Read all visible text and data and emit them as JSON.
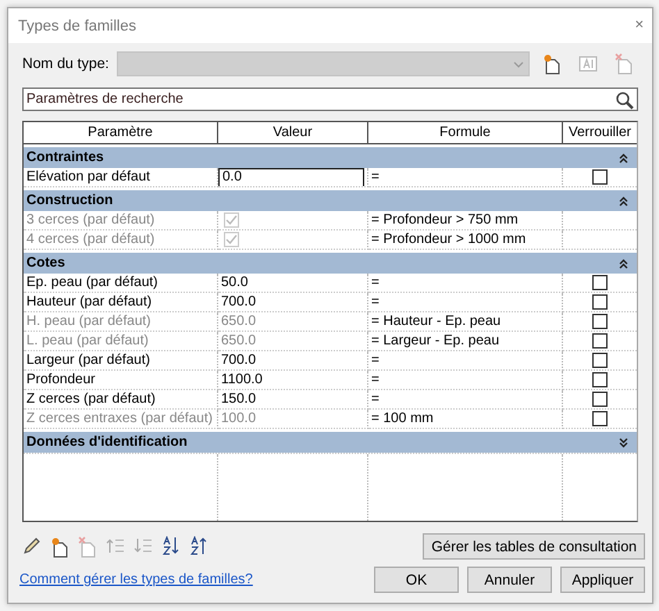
{
  "window": {
    "title": "Types de familles",
    "close": "×"
  },
  "type_name": {
    "label": "Nom du type:",
    "disabled": true
  },
  "type_tools": [
    {
      "kind": "new",
      "disabled": false
    },
    {
      "kind": "rename",
      "disabled": true
    },
    {
      "kind": "delete",
      "disabled": true
    }
  ],
  "search": {
    "placeholder": "Paramètres de recherche"
  },
  "table": {
    "columns": [
      "Paramètre",
      "Valeur",
      "Formule",
      "Verrouiller"
    ],
    "groups": [
      {
        "name": "Contraintes",
        "expanded": true,
        "rows": [
          {
            "parameter": "Elévation par défaut",
            "kind": "text",
            "value": "0.0",
            "editing": true,
            "formula": "=",
            "disabled": false,
            "locked": false
          }
        ]
      },
      {
        "name": "Construction",
        "expanded": true,
        "rows": [
          {
            "parameter": "3 cerces (par défaut)",
            "kind": "check",
            "checked": true,
            "formula": "= Profondeur > 750 mm",
            "disabled": true
          },
          {
            "parameter": "4 cerces (par défaut)",
            "kind": "check",
            "checked": true,
            "formula": "= Profondeur > 1000 mm",
            "disabled": true
          }
        ]
      },
      {
        "name": "Cotes",
        "expanded": true,
        "rows": [
          {
            "parameter": "Ep. peau (par défaut)",
            "kind": "text",
            "value": "50.0",
            "editing": false,
            "formula": "=",
            "disabled": false,
            "locked": false
          },
          {
            "parameter": "Hauteur (par défaut)",
            "kind": "text",
            "value": "700.0",
            "editing": false,
            "formula": "=",
            "disabled": false,
            "locked": false
          },
          {
            "parameter": "H. peau (par défaut)",
            "kind": "text",
            "value": "650.0",
            "editing": false,
            "formula": "= Hauteur - Ep. peau",
            "disabled": true,
            "locked": false
          },
          {
            "parameter": "L. peau (par défaut)",
            "kind": "text",
            "value": "650.0",
            "editing": false,
            "formula": "= Largeur - Ep. peau",
            "disabled": true,
            "locked": false
          },
          {
            "parameter": "Largeur (par défaut)",
            "kind": "text",
            "value": "700.0",
            "editing": false,
            "formula": "=",
            "disabled": false,
            "locked": false
          },
          {
            "parameter": "Profondeur",
            "kind": "text",
            "value": "1100.0",
            "editing": false,
            "formula": "=",
            "disabled": false,
            "locked": false
          },
          {
            "parameter": "Z cerces (par défaut)",
            "kind": "text",
            "value": "150.0",
            "editing": false,
            "formula": "=",
            "disabled": false,
            "locked": false
          },
          {
            "parameter": "Z cerces entraxes (par défaut)",
            "kind": "text",
            "value": "100.0",
            "editing": false,
            "formula": "= 100 mm",
            "disabled": true,
            "locked": false
          }
        ]
      },
      {
        "name": "Données d'identification",
        "expanded": false
      }
    ]
  },
  "tools": [
    {
      "kind": "edit",
      "disabled": false
    },
    {
      "kind": "new",
      "disabled": false
    },
    {
      "kind": "delete",
      "disabled": true
    },
    {
      "kind": "up",
      "disabled": true
    },
    {
      "kind": "down",
      "disabled": true
    },
    {
      "kind": "sort_asc",
      "disabled": false
    },
    {
      "kind": "sort_desc",
      "disabled": false
    }
  ],
  "lookup_button": "Gérer les tables de consultation",
  "help_link": "Comment gérer les types de familles?",
  "buttons": [
    "OK",
    "Annuler",
    "Appliquer"
  ]
}
